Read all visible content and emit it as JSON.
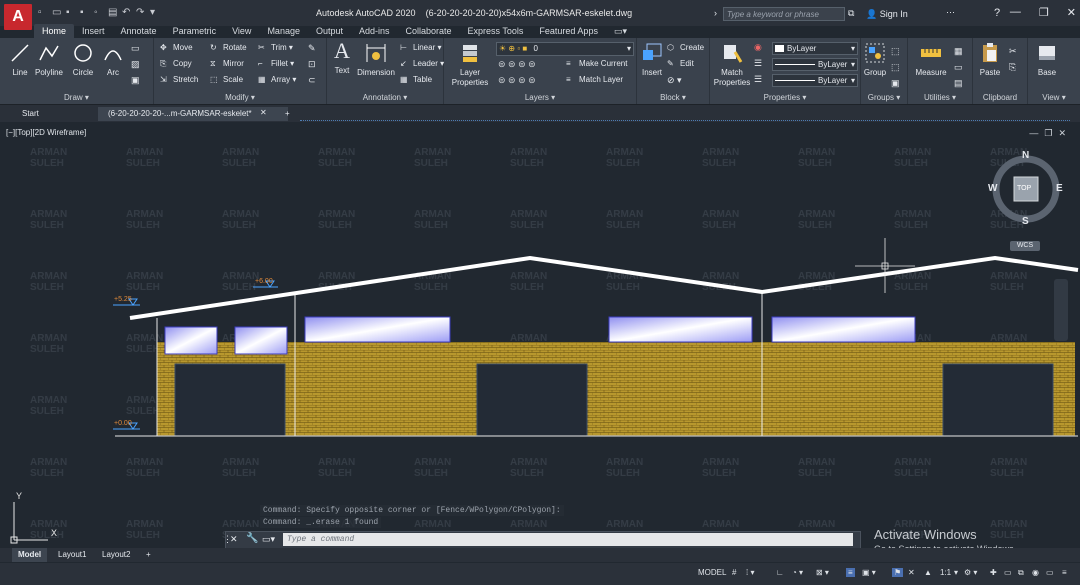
{
  "app": {
    "logo_letter": "A",
    "title": "Autodesk AutoCAD 2020",
    "document_title": "(6-20-20-20-20-20)x54x6m-GARMSAR-eskelet.dwg",
    "search_placeholder": "Type a keyword or phrase",
    "sign_in": "Sign In"
  },
  "ribbon_tabs": [
    "Home",
    "Insert",
    "Annotate",
    "Parametric",
    "View",
    "Manage",
    "Output",
    "Add-ins",
    "Collaborate",
    "Express Tools",
    "Featured Apps"
  ],
  "ribbon": {
    "draw": {
      "label": "Draw",
      "tools": [
        "Line",
        "Polyline",
        "Circle",
        "Arc"
      ]
    },
    "modify": {
      "label": "Modify",
      "tools": [
        "Move",
        "Rotate",
        "Trim",
        "Copy",
        "Mirror",
        "Fillet",
        "Stretch",
        "Scale",
        "Array"
      ]
    },
    "annotation": {
      "label": "Annotation",
      "tools": [
        "Text",
        "Dimension",
        "Linear",
        "Leader",
        "Table"
      ]
    },
    "layers": {
      "label": "Layers",
      "tools": [
        "Layer Properties",
        "Make Current",
        "Match Layer"
      ],
      "current_layer": "0"
    },
    "block": {
      "label": "Block",
      "tools": [
        "Insert",
        "Create",
        "Edit"
      ]
    },
    "properties": {
      "label": "Properties",
      "tools": [
        "Match Properties"
      ],
      "color": "ByLayer",
      "linetype": "ByLayer",
      "lineweight": "ByLayer"
    },
    "groups": {
      "label": "Groups",
      "tools": [
        "Group"
      ]
    },
    "utilities": {
      "label": "Utilities",
      "tools": [
        "Measure"
      ]
    },
    "clipboard": {
      "label": "Clipboard",
      "tools": [
        "Paste"
      ]
    },
    "view": {
      "label": "View",
      "tools": [
        "Base"
      ]
    }
  },
  "file_tabs": [
    "Start",
    "(6-20-20-20-20-...m-GARMSAR-eskelet*",
    "+"
  ],
  "viewport": {
    "label": "[−][Top][2D Wireframe]",
    "compass": {
      "n": "N",
      "s": "S",
      "e": "E",
      "w": "W",
      "top": "TOP"
    },
    "wcs": "WCS",
    "ucs_x": "X",
    "ucs_y": "Y",
    "watermark_line1": "ARMAN",
    "watermark_line2": "SULEH"
  },
  "drawing": {
    "elevation_labels": [
      "+6.00",
      "+5.25",
      "+0.00"
    ],
    "colors": {
      "roof": "#ffffff",
      "brick": "#b8982e",
      "window": "#eef0ff",
      "opening": "#232b36"
    }
  },
  "command": {
    "history": [
      "Command: Specify opposite corner or [Fence/WPolygon/CPolygon]:",
      "Command: _.erase 1 found"
    ],
    "placeholder": "Type a command"
  },
  "layout_tabs": [
    "Model",
    "Layout1",
    "Layout2",
    "+"
  ],
  "status": {
    "model": "MODEL",
    "scale": "1:1"
  },
  "activation": {
    "title": "Activate Windows",
    "subtitle": "Go to Settings to activate Windows."
  }
}
